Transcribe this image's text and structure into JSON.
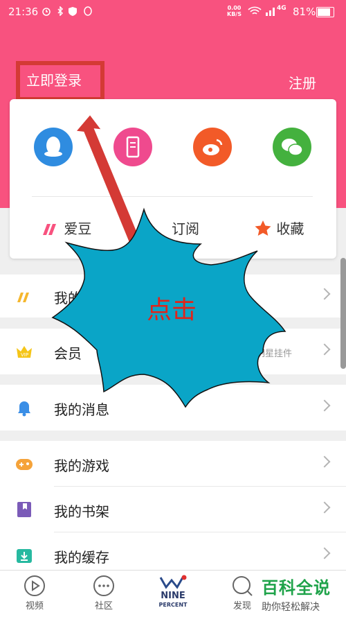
{
  "status_bar": {
    "time": "21:36",
    "net_speed_value": "0.00",
    "net_speed_unit": "KB/S",
    "network": "4G",
    "battery": "81%"
  },
  "header": {
    "login": "立即登录",
    "register": "注册"
  },
  "social_logins": [
    {
      "icon": "qq-icon",
      "color": "#2f8ce0"
    },
    {
      "icon": "phone-icon",
      "color": "#ef4a8e"
    },
    {
      "icon": "weibo-icon",
      "color": "#f25a28"
    },
    {
      "icon": "wechat-icon",
      "color": "#44b13e"
    }
  ],
  "shortcuts": {
    "idol": "爱豆",
    "subscribe": "订阅",
    "favorite": "收藏"
  },
  "menu": {
    "row1": "我的",
    "row2": "会员",
    "row2_extra": "明星挂件",
    "messages": "我的消息",
    "games": "我的游戏",
    "bookshelf": "我的书架",
    "cache": "我的缓存"
  },
  "nav": {
    "video": "视频",
    "community": "社区",
    "nine_line1": "NINE",
    "nine_line2": "PERCENT",
    "discover": "发现"
  },
  "watermark": {
    "title": "百科全说",
    "subtitle": "助你轻松解决"
  },
  "annotation": {
    "text": "点击"
  },
  "colors": {
    "brand_pink": "#f8527f",
    "annotation_red": "#d43a35",
    "starburst_fill": "#0aa5c7"
  }
}
